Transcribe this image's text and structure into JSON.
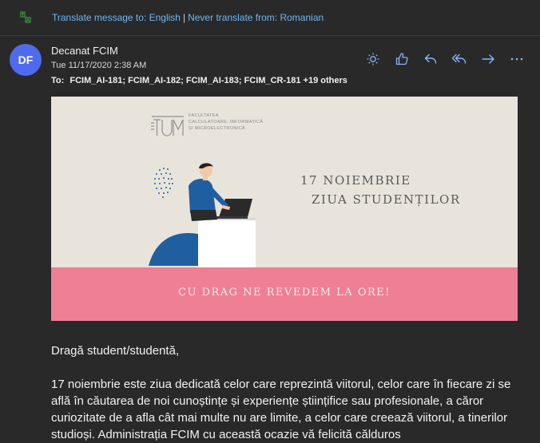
{
  "translate_bar": {
    "translate_link": "Translate message to: English",
    "separator": "|",
    "never_link": "Never translate from: Romanian"
  },
  "message": {
    "avatar_initials": "DF",
    "sender": "Decanat FCIM",
    "date": "Tue 11/17/2020 2:38 AM",
    "to_label": "To:",
    "recipients": "FCIM_AI-181; FCIM_AI-182; FCIM_AI-183; FCIM_CR-181 +19 others",
    "actions": [
      "brightness-icon",
      "like-icon",
      "reply-icon",
      "reply-all-icon",
      "forward-icon",
      "more-icon"
    ]
  },
  "banner": {
    "faculty_text": "FACULTATEA\nCALCULATOARE, INFORMATICĂ\nȘI MICROELECTRONICĂ",
    "title_line1": "17 NOIEMBRIE",
    "title_line2": "ZIUA STUDENȚILOR",
    "footer_text": "CU DRAG NE REVEDEM LA ORE!",
    "colors": {
      "background": "#e8e4dc",
      "pink": "#ef7f94",
      "blue": "#1f5fa0"
    }
  },
  "body": {
    "greeting": "Dragă student/studentă,",
    "paragraph": "17 noiembrie este ziua dedicată celor care reprezintă viitorul, celor care în fiecare zi se află în căutarea de noi cunoștințe și experiențe științifice sau profesionale, a căror curiozitate de a afla cât mai multe nu are limite, a celor care creează viitorul, a tinerilor studioși. Administrația FCIM cu această ocazie vă felicită călduros"
  },
  "colors": {
    "page_bg": "#292929",
    "link": "#6cb8f6",
    "accent": "#4f6bed"
  }
}
